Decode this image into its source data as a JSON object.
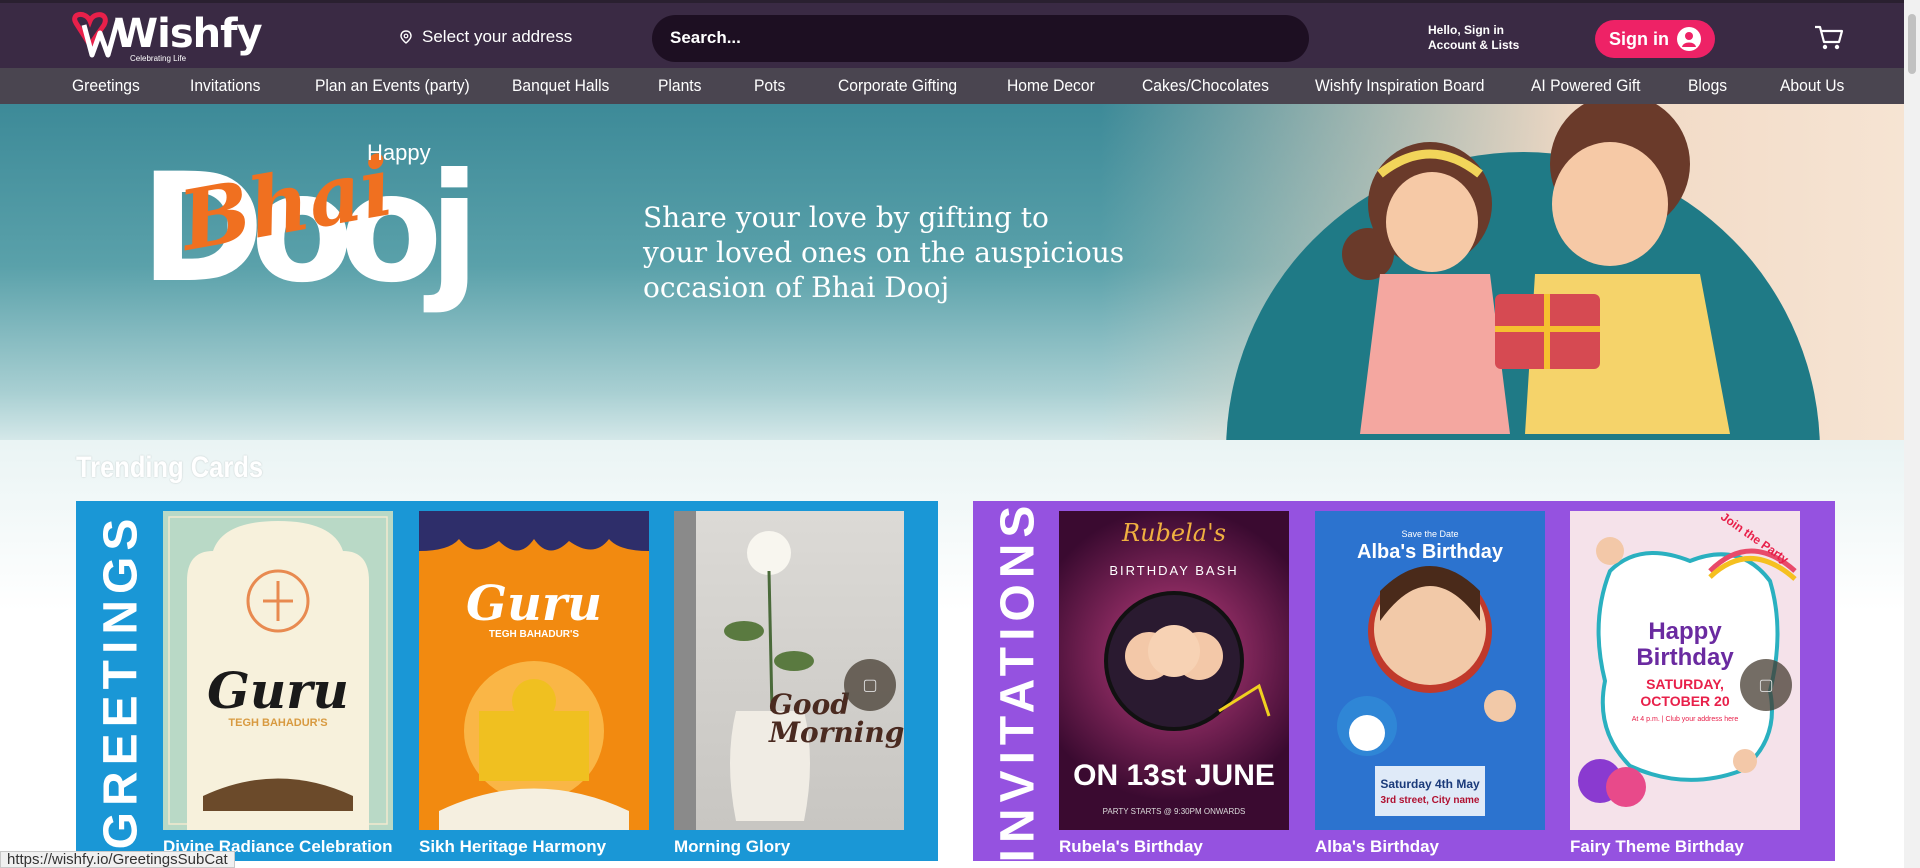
{
  "header": {
    "logo_text": "Wishfy",
    "logo_tagline": "Celebrating Life",
    "address_label": "Select your address",
    "search_placeholder": "Search...",
    "account_greeting": "Hello, Sign in",
    "account_lists": "Account & Lists",
    "signin_label": "Sign in"
  },
  "nav": {
    "items": [
      "Greetings",
      "Invitations",
      "Plan an Events (party)",
      "Banquet Halls",
      "Plants",
      "Pots",
      "Corporate Gifting",
      "Home Decor",
      "Cakes/Chocolates",
      "Wishfy Inspiration Board",
      "AI Powered Gift",
      "Blogs",
      "About Us"
    ]
  },
  "hero": {
    "happy": "Happy",
    "bhai": "Bhai",
    "dooj": "Dooj",
    "tagline_1": "Share your love by gifting to",
    "tagline_2": "your loved ones on the auspicious",
    "tagline_3": "occasion of Bhai Dooj"
  },
  "trending": {
    "title": "Trending Cards",
    "greetings": {
      "label": "GREETINGS",
      "cards": [
        {
          "title": "Divine Radiance Celebration",
          "art_title": "Guru",
          "art_sub": "TEGH BAHADUR'S"
        },
        {
          "title": "Sikh Heritage Harmony",
          "art_title": "Guru",
          "art_sub": "TEGH BAHADUR'S"
        },
        {
          "title": "Morning Glory",
          "art_title": "Good Morning",
          "art_sub": ""
        }
      ]
    },
    "invitations": {
      "label": "INVITATIONS",
      "cards": [
        {
          "title": "Rubela's Birthday",
          "art_name": "Rubela's",
          "art_sub": "BIRTHDAY BASH",
          "art_date": "ON 13st JUNE",
          "art_foot": "PARTY STARTS @ 9:30PM ONWARDS"
        },
        {
          "title": "Alba's Birthday",
          "art_name": "Alba's Birthday",
          "art_sub": "Save the Date",
          "art_date": "Saturday 4th May",
          "art_foot": "3rd street, City name"
        },
        {
          "title": "Fairy Theme Birthday",
          "art_name": "Happy Birthday",
          "art_sub": "Join the Party",
          "art_date": "SATURDAY, OCTOBER 20",
          "art_foot": "At 4 p.m. | Club your address here"
        }
      ]
    }
  },
  "status_bar": {
    "url": "https://wishfy.io/GreetingsSubCat"
  },
  "colors": {
    "topbar": "#3a2a44",
    "nav": "#4a4550",
    "signin": "#ee2266",
    "greetings_panel": "#1a97d6",
    "invitations_panel": "#9552e0"
  }
}
